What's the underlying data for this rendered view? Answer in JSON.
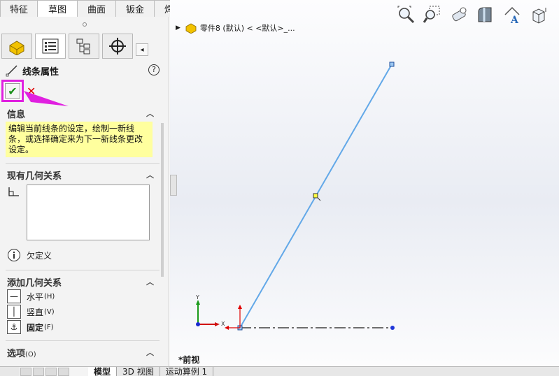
{
  "top_tabs": [
    "特征",
    "草图",
    "曲面",
    "钣金",
    "焊件"
  ],
  "active_top_tab": 1,
  "panel": {
    "title": "线条属性",
    "help": "?",
    "info_heading": "信息",
    "info_text": "编辑当前线条的设定，绘制一新线条，或选择确定来为下一新线条更改设定。",
    "existing_relations_heading": "现有几何关系",
    "status": "欠定义",
    "add_relations_heading": "添加几何关系",
    "relations": [
      {
        "label": "水平",
        "hint": "(H)",
        "icon": "horizontal-line-icon"
      },
      {
        "label": "竖直",
        "hint": "(V)",
        "icon": "vertical-line-icon"
      },
      {
        "label": "固定",
        "hint": "(F)",
        "icon": "anchor-icon",
        "bold": true
      }
    ],
    "options_heading": "选项",
    "options_hint": "(O)"
  },
  "canvas": {
    "document_crumb": "零件8  (默认)  < <默认>_...",
    "view_label": "*前视",
    "axis_x": "X",
    "axis_y": "Y"
  },
  "bottom_tabs": [
    "模型",
    "3D 视图",
    "运动算例 1"
  ],
  "colors": {
    "accent_magenta": "#e020e0",
    "line_blue": "#62a8e8",
    "info_yellow": "#ffff9e",
    "ok_green": "#1a8f1a",
    "cancel_red": "#e00000"
  }
}
